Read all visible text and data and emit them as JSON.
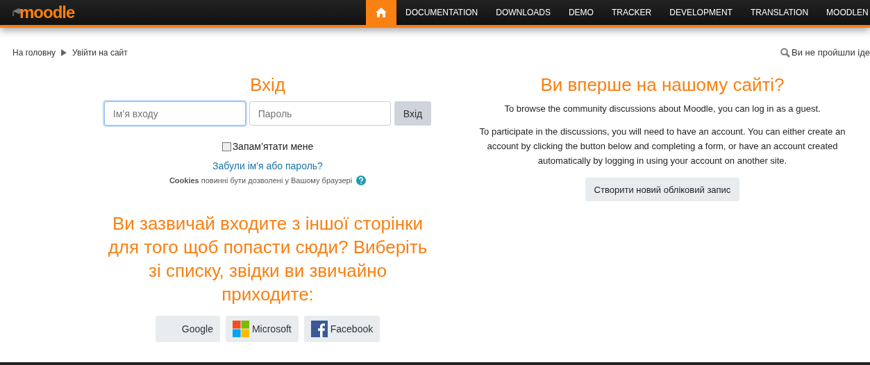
{
  "header": {
    "logo": "moodle",
    "nav": [
      {
        "kind": "home",
        "selected": true
      },
      {
        "label": "DOCUMENTATION",
        "selected": false
      },
      {
        "label": "DOWNLOADS",
        "selected": false
      },
      {
        "label": "DEMO",
        "selected": false
      },
      {
        "label": "TRACKER",
        "selected": false
      },
      {
        "label": "DEVELOPMENT",
        "selected": false
      },
      {
        "label": "TRANSLATION",
        "selected": false
      },
      {
        "label": "MOODLEN",
        "selected": false
      }
    ]
  },
  "breadcrumb": [
    "На головну",
    "Увійти на сайт"
  ],
  "login_status": "Ви не пройшли іде",
  "login": {
    "title": "Вхід",
    "username": {
      "placeholder": "Ім’я входу",
      "focused": true
    },
    "password": {
      "placeholder": "Пароль"
    },
    "submit": "Вхід",
    "remember": {
      "label": "Запам’ятати мене",
      "checked": false
    },
    "forgot": "Забули ім'я або пароль?",
    "cookies": "**Cookies** повинні бути дозволені у Вашому браузері"
  },
  "other_site": {
    "title": "Ви зазвичай входите з іншої сторінки для того щоб попасти сюди? Виберіть зі списку, звідки ви звичайно приходите:",
    "providers": [
      {
        "kind": "google",
        "label": "Google"
      },
      {
        "kind": "microsoft",
        "label": "Microsoft"
      },
      {
        "kind": "facebook",
        "label": "Facebook"
      }
    ]
  },
  "first_time": {
    "title": "Ви вперше на нашому сайті?",
    "paragraphs": [
      "To browse the community discussions about Moodle, you can log in as a guest.",
      "To participate in the discussions, you will need to have an account. You can either create an account by clicking the button below and completing a form, or have an account created automatically by logging in using your account on another site."
    ],
    "button": "Створити новий обліковий запис"
  }
}
